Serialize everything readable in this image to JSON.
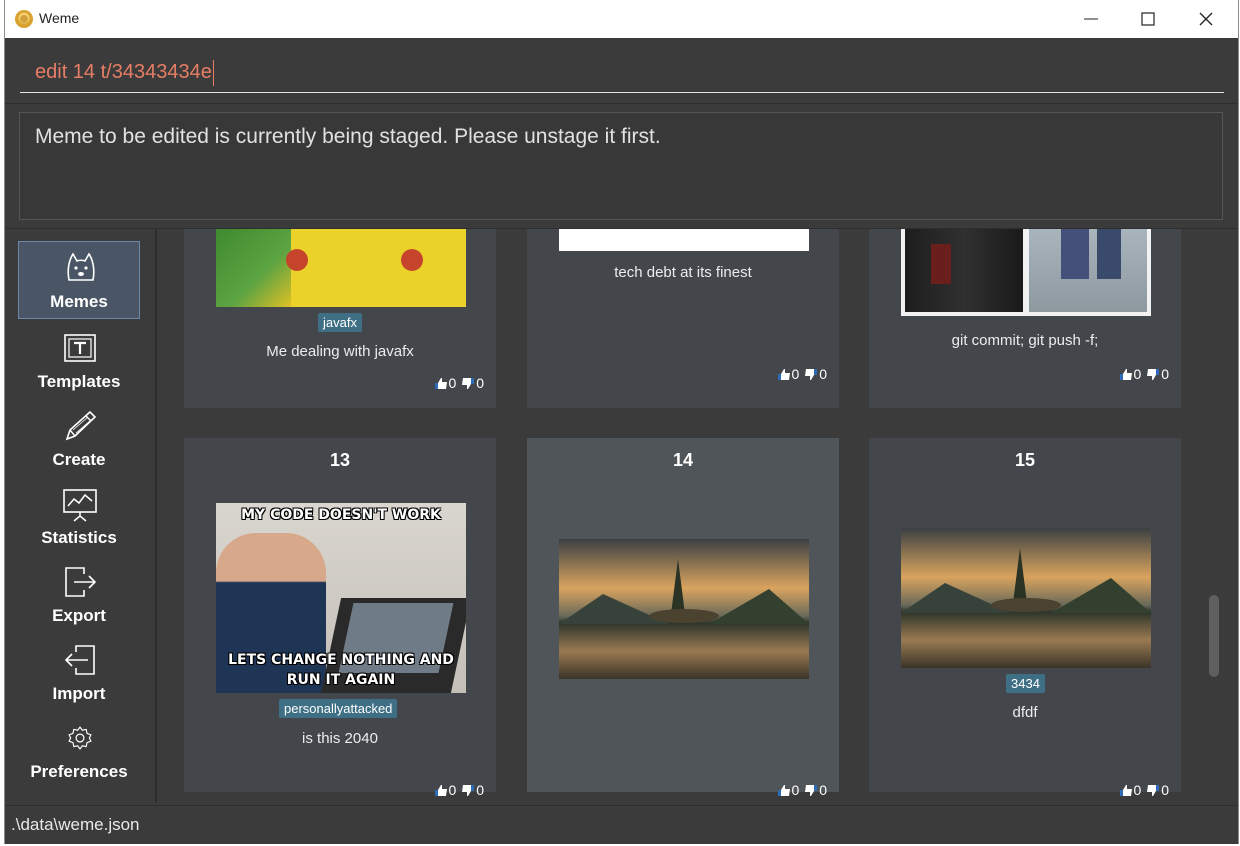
{
  "window": {
    "title": "Weme"
  },
  "command": {
    "value": "edit 14 t/34343434e"
  },
  "result": {
    "message": "Meme to be edited is currently being staged. Please unstage it first."
  },
  "sidebar": {
    "items": [
      {
        "label": "Memes",
        "icon": "doge-icon",
        "active": true
      },
      {
        "label": "Templates",
        "icon": "template-icon",
        "active": false
      },
      {
        "label": "Create",
        "icon": "pencil-icon",
        "active": false
      },
      {
        "label": "Statistics",
        "icon": "chart-board-icon",
        "active": false
      },
      {
        "label": "Export",
        "icon": "export-icon",
        "active": false
      },
      {
        "label": "Import",
        "icon": "import-icon",
        "active": false
      },
      {
        "label": "Preferences",
        "icon": "gear-icon",
        "active": false
      }
    ]
  },
  "memes": [
    {
      "index": "",
      "tag": "javafx",
      "description": "Me dealing with javafx",
      "likes": "0",
      "dislikes": "0"
    },
    {
      "index": "",
      "tag": "",
      "description": "tech debt at its finest",
      "likes": "0",
      "dislikes": "0"
    },
    {
      "index": "",
      "tag": "",
      "description": "git commit; git push -f;",
      "likes": "0",
      "dislikes": "0"
    },
    {
      "index": "13",
      "tag": "personallyattacked",
      "description": "is this 2040",
      "likes": "0",
      "dislikes": "0",
      "image_caption_top": "MY CODE DOESN'T WORK",
      "image_caption_bottom": "LETS CHANGE NOTHING AND RUN IT AGAIN"
    },
    {
      "index": "14",
      "tag": "",
      "description": "",
      "likes": "0",
      "dislikes": "0"
    },
    {
      "index": "15",
      "tag": "3434",
      "description": "dfdf",
      "likes": "0",
      "dislikes": "0"
    }
  ],
  "status": {
    "path": ".\\data\\weme.json"
  },
  "colors": {
    "accent": "#e77d65",
    "tag_bg": "#3f6f85",
    "card_bg": "#43474b",
    "selected_card_bg": "#505559",
    "app_bg": "#3b3b3b"
  }
}
